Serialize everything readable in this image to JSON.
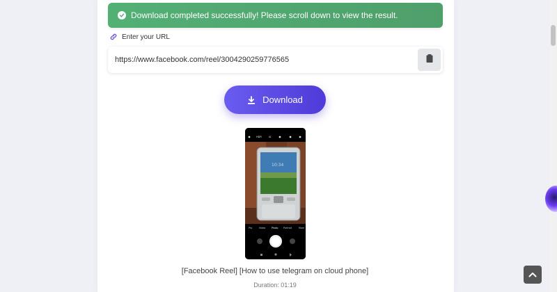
{
  "alert": {
    "message": "Download completed successfully! Please scroll down to view the result.",
    "icon": "check-circle-icon",
    "color": "#53b075"
  },
  "url_section": {
    "label": "Enter your URL",
    "label_icon": "link-icon",
    "value": "https://www.facebook.com/reel/3004290259776565",
    "paste_icon": "clipboard-icon"
  },
  "download_button": {
    "label": "Download",
    "icon": "download-icon",
    "color": "#5b46e6"
  },
  "result": {
    "title": "[Facebook Reel] [How to use telegram on cloud phone]",
    "duration": "Duration: 01:19"
  },
  "thumbnail": {
    "top_bar": [
      "HDR",
      "AI"
    ],
    "modes": [
      "Pro",
      "Video",
      "Photo",
      "Portrait",
      "More"
    ]
  },
  "back_to_top_icon": "chevron-up-icon"
}
